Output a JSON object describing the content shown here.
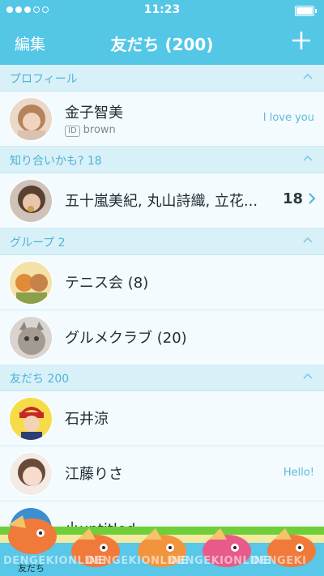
{
  "status_bar": {
    "signal_dots": [
      true,
      true,
      true,
      false,
      false
    ],
    "time": "11:23",
    "battery_level": 0.9
  },
  "nav": {
    "edit_label": "編集",
    "title": "友だち (200)",
    "add_icon": "plus-icon"
  },
  "sections": {
    "profile": {
      "label": "プロフィール"
    },
    "suggested": {
      "label": "知り合いかも? 18"
    },
    "groups": {
      "label": "グループ 2"
    },
    "friends": {
      "label": "友だち 200"
    }
  },
  "profile": {
    "name": "金子智美",
    "id_badge": "ID",
    "line_id": "brown",
    "status": "I love you"
  },
  "suggested": {
    "names": "五十嵐美紀, 丸山詩織, 立花...",
    "count": "18"
  },
  "groups": [
    {
      "name": "テニス会 (8)"
    },
    {
      "name": "グルメクラブ (20)"
    }
  ],
  "friends": [
    {
      "name": "石井涼",
      "status": ""
    },
    {
      "name": "江藤りさ",
      "status": "Hello!"
    },
    {
      "name": "小untitled",
      "status": ""
    }
  ],
  "tab_bar": {
    "friends_label": "友だち"
  },
  "watermarks": [
    "DENGEKIONLINE",
    "DENGEKIONLINE",
    "DENGEKIONLINE",
    "DENGEKI"
  ],
  "colors": {
    "accent": "#54c6e6",
    "section_bg": "#d8f0f8",
    "row_bg": "#f3fbfe"
  }
}
